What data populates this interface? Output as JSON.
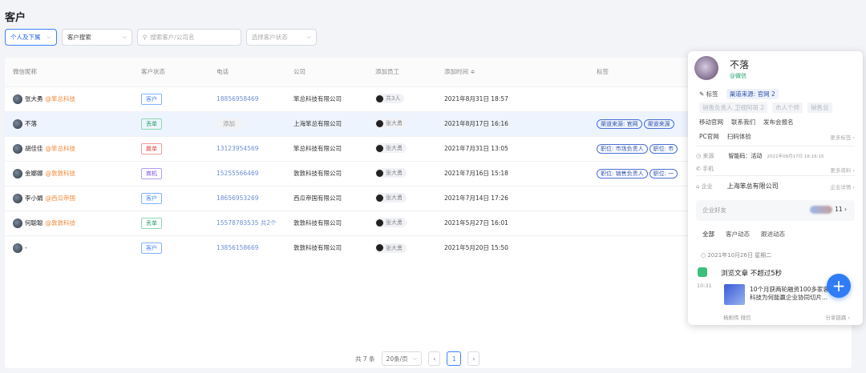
{
  "page": {
    "title": "客户"
  },
  "filters": {
    "scope": "个人及下属",
    "search_type": "客户搜索",
    "search_placeholder": "搜索客户/公司名",
    "status_placeholder": "选择客户状态"
  },
  "table": {
    "headers": [
      "微信昵称",
      "客户状态",
      "电话",
      "公司",
      "添加员工",
      "添加时间 ≑",
      "标签"
    ],
    "rows": [
      {
        "nick": "张大勇",
        "corp": "@笨总科技",
        "status": "客户",
        "phone": "18856958469",
        "company": "笨总科技有限公司",
        "staff": "共3人",
        "time": "2021年8月31日 18:57",
        "labels": []
      },
      {
        "nick": "不落",
        "corp": "",
        "status": "丢单",
        "phone": "添加",
        "company": "上海笨总有限公司",
        "staff": "张大勇",
        "time": "2021年8月17日 16:16",
        "labels": [
          "渠道来源: 官网",
          "渠道来源"
        ]
      },
      {
        "nick": "胡佳佳",
        "corp": "@笨总科技",
        "status": "赢单",
        "phone": "13123954569",
        "company": "笨总科技有限公司",
        "staff": "张大勇",
        "time": "2021年7月31日 13:05",
        "labels": [
          "职位: 市场负责人",
          "职位: 市"
        ]
      },
      {
        "nick": "金娜娜",
        "corp": "@敦敦科技",
        "status": "商机",
        "phone": "15255566469",
        "company": "敦敦科技有限公司",
        "staff": "张大勇",
        "time": "2021年7月16日 15:18",
        "labels": [
          "职位: 销售负责人",
          "职位: 一"
        ]
      },
      {
        "nick": "李小娟",
        "corp": "@西瓜帝国",
        "status": "客户",
        "phone": "18656953269",
        "company": "西瓜帝国有限公司",
        "staff": "张大勇",
        "time": "2021年7月14日 17:26",
        "labels": []
      },
      {
        "nick": "何聪聪",
        "corp": "@敦敦科技",
        "status": "丢单",
        "phone": "15578783535 共2个",
        "company": "敦敦科技有限公司",
        "staff": "张大勇",
        "time": "2021年5月27日 16:01",
        "labels": []
      },
      {
        "nick": "-",
        "corp": "",
        "status": "客户",
        "phone": "13856158669",
        "company": "敦敦科技有限公司",
        "staff": "张大勇",
        "time": "2021年5月20日 15:50",
        "labels": []
      }
    ]
  },
  "pager": {
    "total": "共 7 条",
    "page_size": "20条/页",
    "prev": "‹",
    "current": "1",
    "next": "›"
  },
  "drawer": {
    "name": "不落",
    "source_badge": "@微信",
    "tag_label": "✎ 标签",
    "tag_chips": [
      "渠道来源: 官网  2"
    ],
    "blur_chips": [
      "销售负责人 卫视阿哥 2",
      "市人个师",
      "销售总"
    ],
    "action_chips": [
      "移动官网",
      "联系我们",
      "发布会报名"
    ],
    "action_chips2": [
      "PC官网",
      "扫码体验"
    ],
    "more_tags": "更多标签 ›",
    "source_key": "◷ 来源",
    "source_val": "智能码：活动",
    "source_time": "2021年08月17日 16:16:15",
    "phone_key": "✆ 手机",
    "more_info": "更多资料 ›",
    "company_key": "⌂ 企业",
    "company_val": "上海笨总有限公司",
    "company_detail": "企业详情 ›",
    "friends_label": "企业好友",
    "friends_count": "11",
    "tabs": [
      "全部",
      "客户动态",
      "跟进动态"
    ],
    "date": "○  2021年10月26日 星期二",
    "event_title": "浏览文章 不超过5秒",
    "event_time": "10:31",
    "event_text": "10个月获两轮融资100多家客 卫瓴科技为何能赢企业协同切片...",
    "event_user": "杨剧伟  微信",
    "event_share": "分享链路 ›"
  },
  "fab": {
    "label": "+"
  }
}
